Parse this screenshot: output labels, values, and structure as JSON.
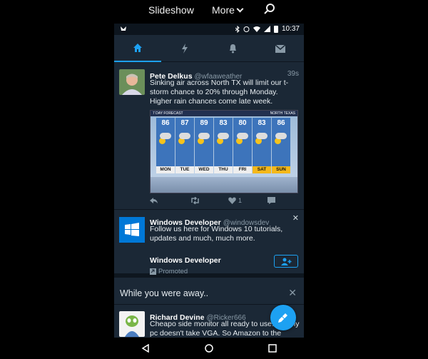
{
  "gallery": {
    "slideshow": "Slideshow",
    "more": "More"
  },
  "status": {
    "time": "10:37"
  },
  "tweet1": {
    "name": "Pete Delkus",
    "handle": "@wfaaweather",
    "time": "39s",
    "text": "Sinking air across North TX will limit our t-storm chance to 20% through Monday. Higher rain chances come late week.",
    "like_count": "1",
    "forecast": {
      "title": "7 DAY FORECAST",
      "region": "NORTH TEXAS",
      "days": [
        {
          "day": "MON",
          "temp": "86"
        },
        {
          "day": "TUE",
          "temp": "87"
        },
        {
          "day": "WED",
          "temp": "89"
        },
        {
          "day": "THU",
          "temp": "83"
        },
        {
          "day": "FRI",
          "temp": "80"
        },
        {
          "day": "SAT",
          "temp": "83"
        },
        {
          "day": "SUN",
          "temp": "86"
        }
      ]
    }
  },
  "promo": {
    "name": "Windows Developer",
    "handle": "@windowsdev",
    "text": "Follow us here for Windows 10 tutorials, updates and much, much more.",
    "footer_name": "Windows Developer",
    "promoted": "Promoted"
  },
  "away": {
    "title": "While you were away.."
  },
  "tweet2": {
    "name": "Richard Devine",
    "handle": "@Ricker666",
    "text": "Cheapo side monitor all ready to use. But my pc doesn't take VGA. So Amazon to the"
  },
  "colors": {
    "accent": "#1da1f2",
    "background": "#1b2836"
  }
}
